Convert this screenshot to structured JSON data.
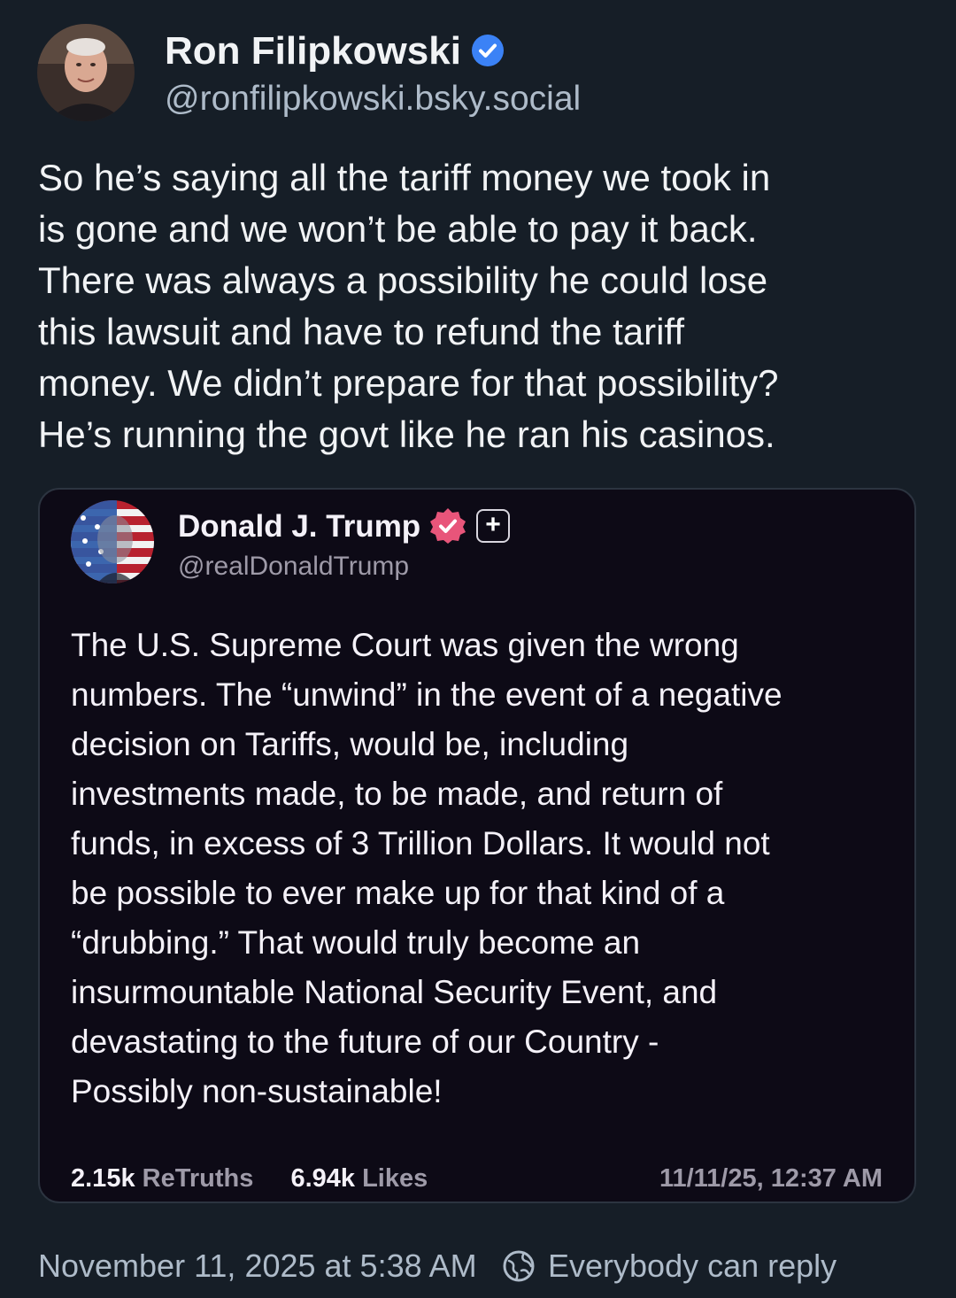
{
  "post": {
    "author": {
      "name": "Ron Filipkowski",
      "handle": "@ronfilipkowski.bsky.social",
      "verified_color": "#3b82f6"
    },
    "text": "So he’s saying all the tariff money we took in\nis gone and we won’t be able to pay it back.\nThere was always a possibility he could lose\nthis lawsuit and have to refund the tariff\nmoney. We didn’t prepare for that possibility?\nHe’s running the govt like he ran his casinos.",
    "timestamp": "November 11, 2025 at 5:38 AM",
    "reply_setting": "Everybody can reply"
  },
  "quote": {
    "author": {
      "name": "Donald J. Trump",
      "handle": "@realDonaldTrump",
      "badge_color": "#e8557a"
    },
    "text": "The U.S. Supreme Court was given the wrong\nnumbers. The “unwind” in the event of a negative\ndecision on Tariffs, would be, including\ninvestments made, to be made, and return of\nfunds, in excess of 3 Trillion Dollars. It would not\nbe possible to ever make up for that kind of a\n“drubbing.” That would truly become an\ninsurmountable National Security Event, and\ndevastating to the future of our Country -\nPossibly non-sustainable!",
    "stats": {
      "retruths_count": "2.15k",
      "retruths_label": "ReTruths",
      "likes_count": "6.94k",
      "likes_label": "Likes"
    },
    "timestamp": "11/11/25, 12:37 AM"
  },
  "colors": {
    "background": "#161e27",
    "card_background": "#0d0a16",
    "muted_text": "#aebbc9"
  }
}
